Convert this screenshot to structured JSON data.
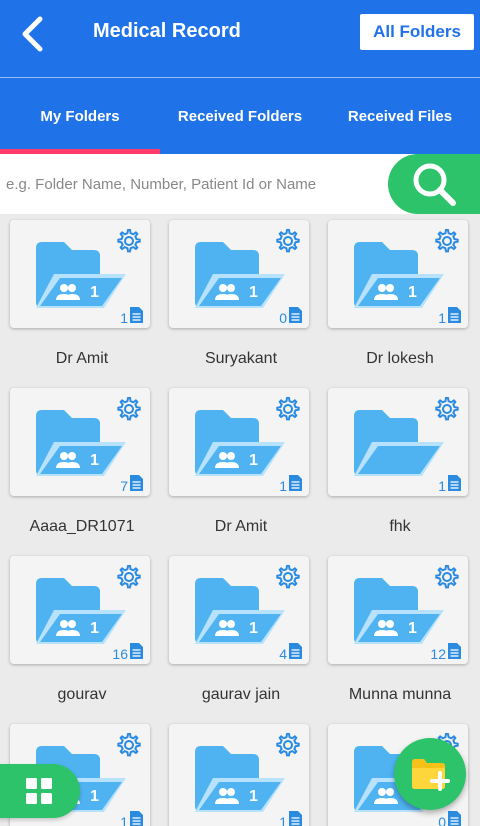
{
  "header": {
    "title": "Medical Record",
    "all_folders_label": "All Folders",
    "back_icon": "chevron-left-icon"
  },
  "tabs": [
    {
      "label": "My Folders",
      "active": true
    },
    {
      "label": "Received Folders",
      "active": false
    },
    {
      "label": "Received Files",
      "active": false
    }
  ],
  "search": {
    "placeholder": "e.g. Folder Name, Number, Patient Id or Name",
    "value": ""
  },
  "colors": {
    "primary": "#1f72e8",
    "accent_green": "#2cc36a",
    "tab_indicator": "#ff3b6b",
    "folder_blue": "#4fb3f2"
  },
  "folders": [
    {
      "name": "Dr Amit",
      "members": "1",
      "files": "1"
    },
    {
      "name": "Suryakant",
      "members": "1",
      "files": "0"
    },
    {
      "name": "Dr lokesh",
      "members": "1",
      "files": "1"
    },
    {
      "name": "Aaaa_DR1071",
      "members": "1",
      "files": "7"
    },
    {
      "name": "Dr Amit",
      "members": "1",
      "files": "1"
    },
    {
      "name": "fhk",
      "members": "",
      "files": "1"
    },
    {
      "name": "gourav",
      "members": "1",
      "files": "16"
    },
    {
      "name": "gaurav jain",
      "members": "1",
      "files": "4"
    },
    {
      "name": "Munna munna",
      "members": "1",
      "files": "12"
    },
    {
      "name": "",
      "members": "1",
      "files": "1"
    },
    {
      "name": "",
      "members": "1",
      "files": "1"
    },
    {
      "name": "",
      "members": "1",
      "files": "0"
    }
  ]
}
